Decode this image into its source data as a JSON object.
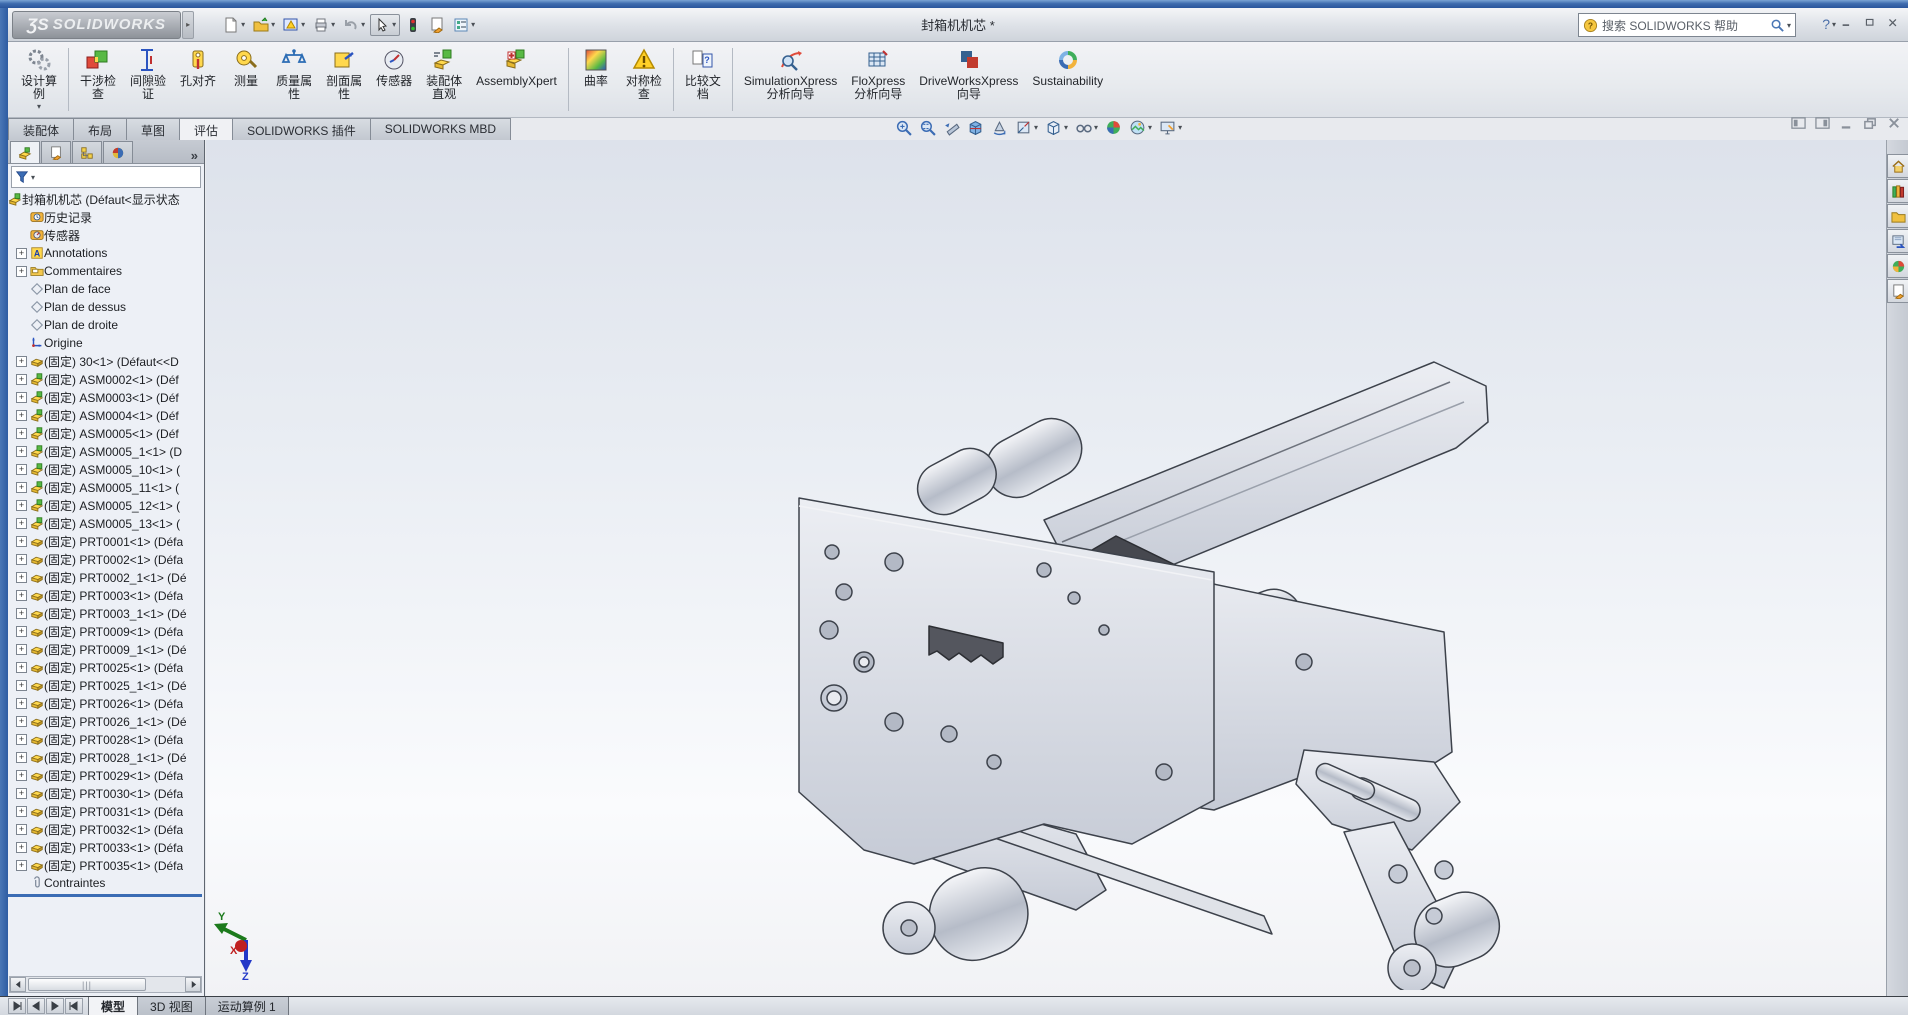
{
  "window": {
    "title": "封箱机机芯 *",
    "logo_glyph": "ƷS",
    "logo_text": "SOLIDWORKS",
    "search_placeholder": "搜索 SOLIDWORKS 帮助",
    "help_label": "?"
  },
  "colors": {
    "frame_blue": "#2e5ca2",
    "tab_active_bg": "#f0f1f4",
    "tree_split_blue": "#3b6cb4",
    "viewport_top": "#dde2eb",
    "viewport_bottom": "#fafbfd",
    "metal_gray": "#d4d8e0",
    "knurl_dark": "#46484f"
  },
  "titlebar_toolbar": [
    {
      "name": "new-document",
      "icon": "new-document",
      "caret": true
    },
    {
      "name": "open",
      "icon": "open-folder",
      "caret": true
    },
    {
      "name": "picture-warning",
      "icon": "picture-warning",
      "caret": true
    },
    {
      "name": "print",
      "icon": "print",
      "caret": true
    },
    {
      "name": "undo",
      "icon": "undo",
      "caret": true
    },
    {
      "name": "select",
      "icon": "select-cursor",
      "caret": true,
      "pressed": true
    },
    {
      "name": "rebuild",
      "icon": "rebuild-traffic-light",
      "caret": false
    },
    {
      "name": "file-properties",
      "icon": "file-properties",
      "caret": false
    },
    {
      "name": "options",
      "icon": "options-list",
      "caret": true
    }
  ],
  "ribbon": {
    "groups": [
      {
        "buttons": [
          {
            "name": "design-study",
            "icon": "design-study",
            "label": "设计算\n例",
            "dropdown": true
          }
        ]
      },
      {
        "buttons": [
          {
            "name": "interference-check",
            "icon": "interference",
            "label": "干涉检\n查"
          },
          {
            "name": "clearance-verify",
            "icon": "clearance",
            "label": "间隙验\n证"
          },
          {
            "name": "hole-alignment",
            "icon": "hole-align",
            "label": "孔对齐"
          },
          {
            "name": "measure",
            "icon": "measure",
            "label": "测量"
          },
          {
            "name": "mass-properties",
            "icon": "mass-props",
            "label": "质量属\n性"
          },
          {
            "name": "section-properties",
            "icon": "section-props",
            "label": "剖面属\n性"
          },
          {
            "name": "sensors",
            "icon": "sensor-gauge",
            "label": "传感器"
          },
          {
            "name": "assembly-visualization",
            "icon": "assembly-visual",
            "label": "装配体\n直观"
          },
          {
            "name": "assemblyxpert",
            "icon": "assemblyxpert",
            "label": "AssemblyXpert"
          }
        ]
      },
      {
        "buttons": [
          {
            "name": "curvature",
            "icon": "curvature",
            "label": "曲率"
          },
          {
            "name": "symmetry-check",
            "icon": "symmetry-check",
            "label": "对称检\n查"
          }
        ]
      },
      {
        "buttons": [
          {
            "name": "compare-documents",
            "icon": "compare-doc",
            "label": "比较文\n档"
          }
        ]
      },
      {
        "buttons": [
          {
            "name": "simulationxpress",
            "icon": "simulationxpress",
            "label": "SimulationXpress\n分析向导"
          },
          {
            "name": "floxpress",
            "icon": "floxpress",
            "label": "FloXpress\n分析向导"
          },
          {
            "name": "driveworksxpress",
            "icon": "driveworks",
            "label": "DriveWorksXpress\n向导"
          },
          {
            "name": "sustainability",
            "icon": "sustainability",
            "label": "Sustainability"
          }
        ]
      }
    ]
  },
  "command_tabs": [
    {
      "label": "装配体",
      "active": false
    },
    {
      "label": "布局",
      "active": false
    },
    {
      "label": "草图",
      "active": false
    },
    {
      "label": "评估",
      "active": true
    },
    {
      "label": "SOLIDWORKS 插件",
      "active": false
    },
    {
      "label": "SOLIDWORKS MBD",
      "active": false
    }
  ],
  "headsup_toolbar": [
    {
      "name": "zoom-to-fit",
      "icon": "zoom-fit",
      "caret": false
    },
    {
      "name": "zoom-to-area",
      "icon": "zoom-area",
      "caret": false
    },
    {
      "name": "previous-view",
      "icon": "previous-view",
      "caret": false
    },
    {
      "name": "section-view",
      "icon": "section-view",
      "caret": false
    },
    {
      "name": "rotate-view",
      "icon": "rotate-view",
      "caret": false
    },
    {
      "name": "view-orientation",
      "icon": "view-orientation",
      "caret": true
    },
    {
      "name": "display-style",
      "icon": "display-style",
      "caret": true
    },
    {
      "name": "hide-show-items",
      "icon": "hide-show",
      "caret": true
    },
    {
      "name": "edit-appearance",
      "icon": "edit-appearance",
      "caret": false
    },
    {
      "name": "apply-scene",
      "icon": "apply-scene",
      "caret": true
    },
    {
      "name": "view-settings",
      "icon": "view-settings",
      "caret": true
    }
  ],
  "doc_window_buttons": [
    {
      "name": "toggle-left-pane",
      "icon": "pane-left"
    },
    {
      "name": "toggle-right-pane",
      "icon": "pane-right"
    },
    {
      "name": "minimize-doc",
      "icon": "doc-minimize"
    },
    {
      "name": "restore-doc",
      "icon": "doc-restore"
    },
    {
      "name": "close-doc",
      "icon": "doc-close"
    }
  ],
  "tree": {
    "tabs": [
      {
        "name": "featuremanager",
        "icon": "featuremanager",
        "active": true
      },
      {
        "name": "propertymanager",
        "icon": "propertymanager",
        "active": false
      },
      {
        "name": "configurationmanager",
        "icon": "configurationmanager",
        "active": false
      },
      {
        "name": "displaymanager",
        "icon": "displaymanager",
        "active": false
      }
    ],
    "overflow_chevron": "»",
    "root": {
      "icon": "assembly",
      "label": "封箱机机芯  (Défaut<显示状态"
    },
    "items": [
      {
        "icon": "history",
        "label": "历史记录",
        "expand": false
      },
      {
        "icon": "sensors",
        "label": "传感器",
        "expand": false
      },
      {
        "icon": "annotations",
        "label": "Annotations",
        "expand": true
      },
      {
        "icon": "comments",
        "label": "Commentaires",
        "expand": true
      },
      {
        "icon": "plane",
        "label": "Plan de face",
        "expand": false
      },
      {
        "icon": "plane",
        "label": "Plan de dessus",
        "expand": false
      },
      {
        "icon": "plane",
        "label": "Plan de droite",
        "expand": false
      },
      {
        "icon": "origin",
        "label": "Origine",
        "expand": false
      },
      {
        "icon": "part",
        "label": "(固定) 30<1> (Défaut<<D",
        "expand": true
      },
      {
        "icon": "assembly",
        "label": "(固定) ASM0002<1> (Déf",
        "expand": true
      },
      {
        "icon": "assembly",
        "label": "(固定) ASM0003<1> (Déf",
        "expand": true
      },
      {
        "icon": "assembly",
        "label": "(固定) ASM0004<1> (Déf",
        "expand": true
      },
      {
        "icon": "assembly",
        "label": "(固定) ASM0005<1> (Déf",
        "expand": true
      },
      {
        "icon": "assembly",
        "label": "(固定) ASM0005_1<1> (D",
        "expand": true
      },
      {
        "icon": "assembly",
        "label": "(固定) ASM0005_10<1> (",
        "expand": true
      },
      {
        "icon": "assembly",
        "label": "(固定) ASM0005_11<1> (",
        "expand": true
      },
      {
        "icon": "assembly",
        "label": "(固定) ASM0005_12<1> (",
        "expand": true
      },
      {
        "icon": "assembly",
        "label": "(固定) ASM0005_13<1> (",
        "expand": true
      },
      {
        "icon": "part",
        "label": "(固定) PRT0001<1> (Défa",
        "expand": true
      },
      {
        "icon": "part",
        "label": "(固定) PRT0002<1> (Défa",
        "expand": true
      },
      {
        "icon": "part",
        "label": "(固定) PRT0002_1<1> (Dé",
        "expand": true
      },
      {
        "icon": "part",
        "label": "(固定) PRT0003<1> (Défa",
        "expand": true
      },
      {
        "icon": "part",
        "label": "(固定) PRT0003_1<1> (Dé",
        "expand": true
      },
      {
        "icon": "part",
        "label": "(固定) PRT0009<1> (Défa",
        "expand": true
      },
      {
        "icon": "part",
        "label": "(固定) PRT0009_1<1> (Dé",
        "expand": true
      },
      {
        "icon": "part",
        "label": "(固定) PRT0025<1> (Défa",
        "expand": true
      },
      {
        "icon": "part",
        "label": "(固定) PRT0025_1<1> (Dé",
        "expand": true
      },
      {
        "icon": "part",
        "label": "(固定) PRT0026<1> (Défa",
        "expand": true
      },
      {
        "icon": "part",
        "label": "(固定) PRT0026_1<1> (Dé",
        "expand": true
      },
      {
        "icon": "part",
        "label": "(固定) PRT0028<1> (Défa",
        "expand": true
      },
      {
        "icon": "part",
        "label": "(固定) PRT0028_1<1> (Dé",
        "expand": true
      },
      {
        "icon": "part",
        "label": "(固定) PRT0029<1> (Défa",
        "expand": true
      },
      {
        "icon": "part",
        "label": "(固定) PRT0030<1> (Défa",
        "expand": true
      },
      {
        "icon": "part",
        "label": "(固定) PRT0031<1> (Défa",
        "expand": true
      },
      {
        "icon": "part",
        "label": "(固定) PRT0032<1> (Défa",
        "expand": true
      },
      {
        "icon": "part",
        "label": "(固定) PRT0033<1> (Défa",
        "expand": true
      },
      {
        "icon": "part",
        "label": "(固定) PRT0035<1> (Défa",
        "expand": true
      },
      {
        "icon": "mates",
        "label": "Contraintes",
        "expand": false
      }
    ]
  },
  "taskpane": [
    {
      "name": "home",
      "icon": "home"
    },
    {
      "name": "design-library",
      "icon": "design-library"
    },
    {
      "name": "file-explorer",
      "icon": "file-explorer"
    },
    {
      "name": "view-palette",
      "icon": "view-palette"
    },
    {
      "name": "appearances",
      "icon": "appearances"
    },
    {
      "name": "custom-properties",
      "icon": "custom-properties"
    }
  ],
  "viewport": {
    "triad": {
      "x": "X",
      "y": "Y",
      "z": "Z"
    }
  },
  "bottom": {
    "tabs": [
      {
        "label": "模型",
        "active": true
      },
      {
        "label": "3D 视图",
        "active": false
      },
      {
        "label": "运动算例 1",
        "active": false
      }
    ]
  }
}
